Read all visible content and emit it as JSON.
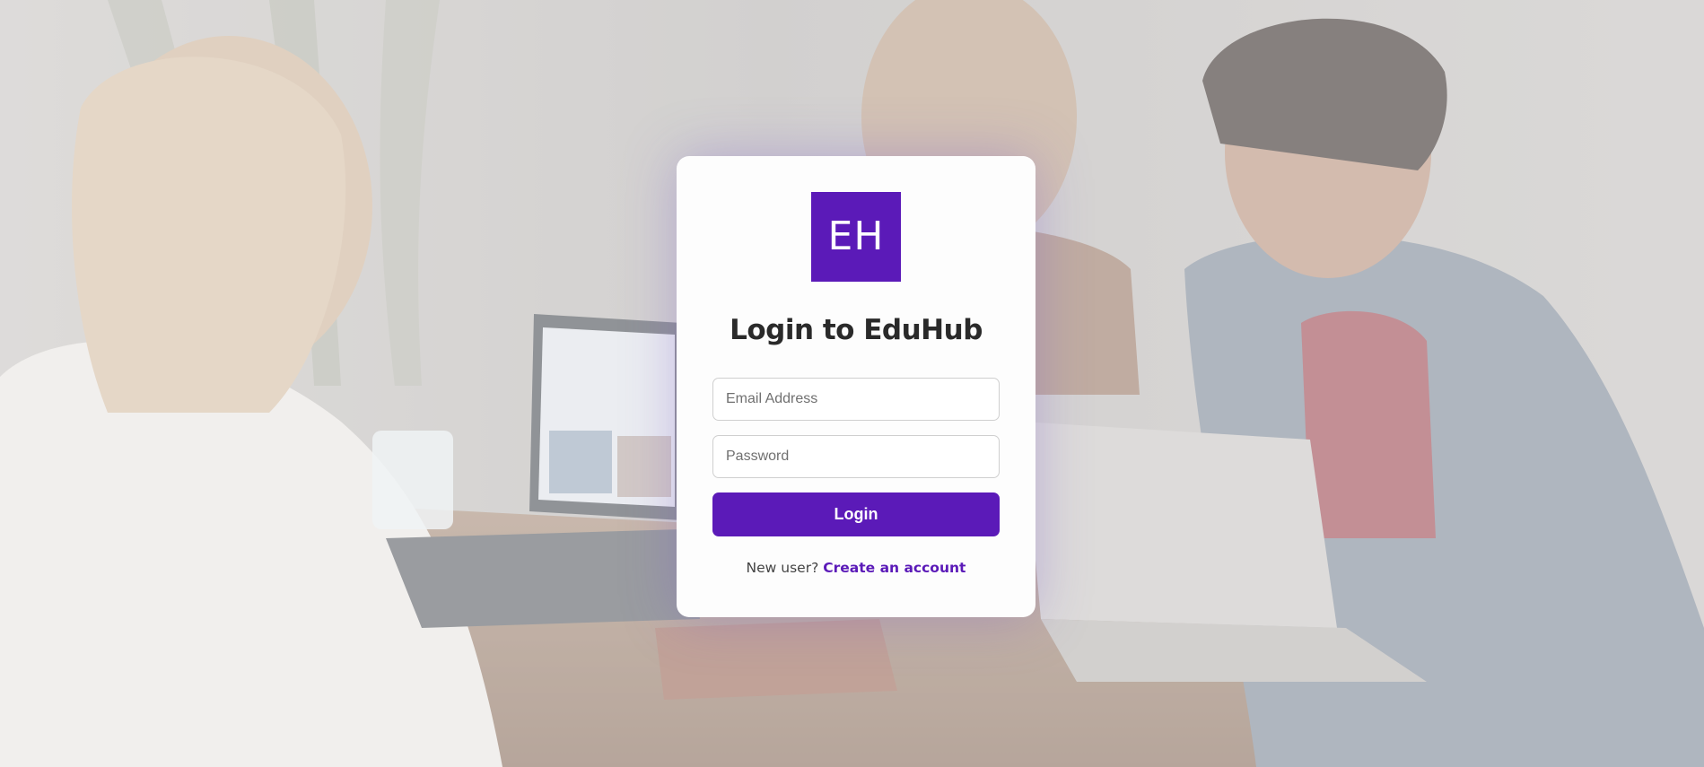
{
  "background": {
    "photo_subject": "three people laughing around a table with laptops"
  },
  "login_card": {
    "logo_text": "EH",
    "title": "Login to EduHub",
    "email_placeholder": "Email Address",
    "password_placeholder": "Password",
    "login_button_label": "Login",
    "new_user_prompt": "New user?",
    "create_account_link": "Create an account"
  },
  "colors": {
    "brand_purple": "#5b1ab8",
    "card_background": "#fdfdfd",
    "title_text": "#2a2a2a"
  }
}
